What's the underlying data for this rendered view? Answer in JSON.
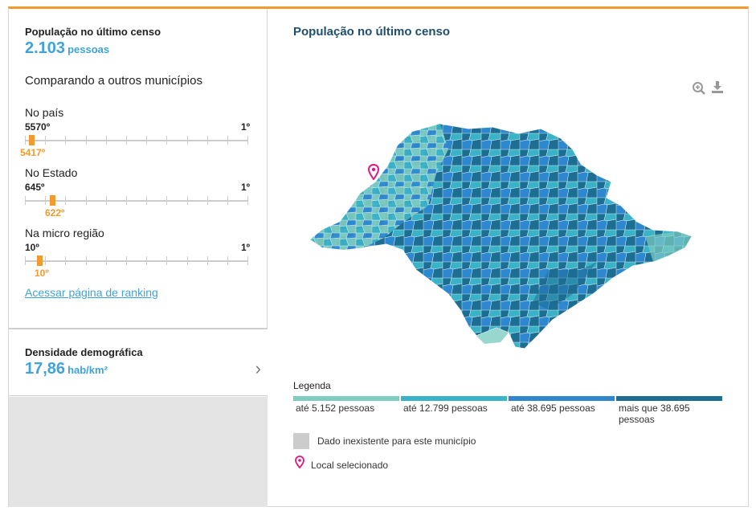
{
  "population": {
    "title": "População no último censo",
    "value": "2.103",
    "unit": "pessoas"
  },
  "compare_heading": "Comparando a outros municípios",
  "rankings": [
    {
      "label": "No país",
      "low": "5570º",
      "high": "1º",
      "marker_label": "5417º",
      "position": 0.028
    },
    {
      "label": "No Estado",
      "low": "645º",
      "high": "1º",
      "marker_label": "622º",
      "position": 0.12
    },
    {
      "label": "Na micro região",
      "low": "10º",
      "high": "1º",
      "marker_label": "10º",
      "position": 0.06
    }
  ],
  "ranking_link": "Acessar página de ranking",
  "density": {
    "title": "Densidade demográfica",
    "value": "17,86",
    "unit": "hab/km²"
  },
  "map": {
    "title": "População no último censo",
    "icons": [
      "zoom-in-icon",
      "download-icon"
    ]
  },
  "legend": {
    "title": "Legenda",
    "items": [
      {
        "label": "até 5.152 pessoas",
        "color": "#7ecdc0"
      },
      {
        "label": "até 12.799 pessoas",
        "color": "#3ab3c8"
      },
      {
        "label": "até 38.695 pessoas",
        "color": "#2e88cf"
      },
      {
        "label": "mais que 38.695 pessoas",
        "color": "#1c6e93"
      }
    ],
    "no_data": "Dado inexistente para este município",
    "selected": "Local selecionado"
  },
  "colors": {
    "accent": "#f29a2e",
    "value": "#3fa3d9",
    "marker": "#e4167d"
  }
}
